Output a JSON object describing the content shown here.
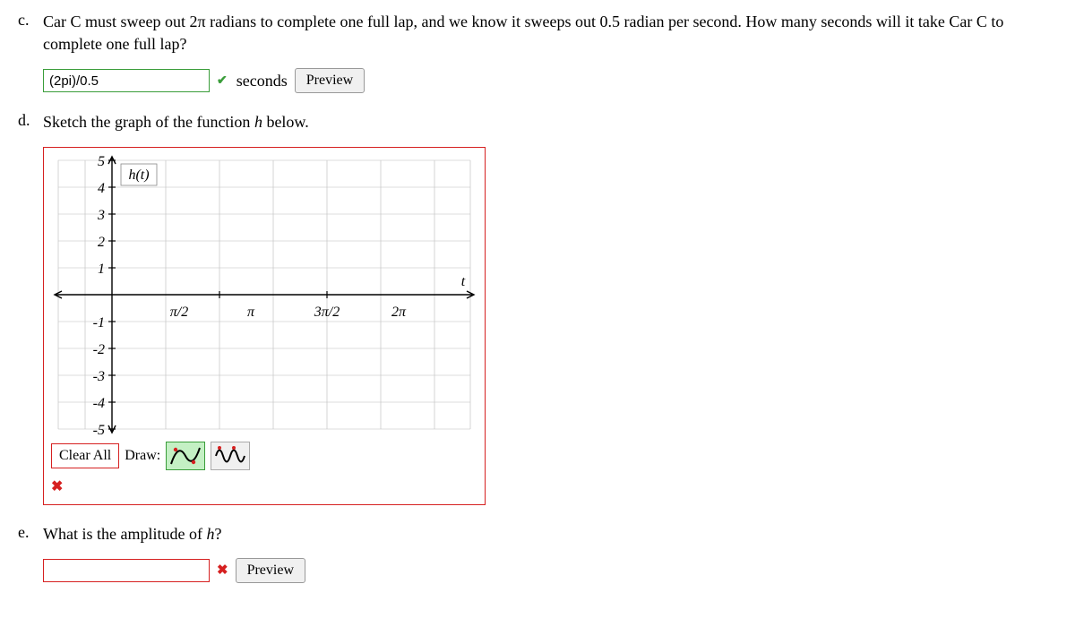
{
  "q_c": {
    "label": "c.",
    "text_before_2pi": "Car C must sweep out ",
    "two_pi": "2π",
    "text_after_2pi": " radians to complete one full lap, and we know it sweeps out 0.5 radian per second. How many seconds will it take Car C to complete one full lap?",
    "input_value": "(2pi)/0.5",
    "unit": "seconds",
    "preview": "Preview"
  },
  "q_d": {
    "label": "d.",
    "text": "Sketch the graph of the function ",
    "func": "h",
    "text_after": " below.",
    "clear_label": "Clear All",
    "draw_label": "Draw:",
    "y_label": "h(t)",
    "x_label": "t"
  },
  "q_e": {
    "label": "e.",
    "text_before": "What is the amplitude of ",
    "func": "h",
    "text_after": "?",
    "preview": "Preview"
  },
  "chart_data": {
    "type": "line",
    "xlabel": "t",
    "ylabel": "h(t)",
    "xticks": [
      "π/2",
      "π",
      "3π/2",
      "2π"
    ],
    "yticks": [
      5,
      4,
      3,
      2,
      1,
      -1,
      -2,
      -3,
      -4,
      -5
    ],
    "xlim": [
      0,
      6.8
    ],
    "ylim": [
      -5,
      5
    ],
    "series": [],
    "grid": true
  }
}
